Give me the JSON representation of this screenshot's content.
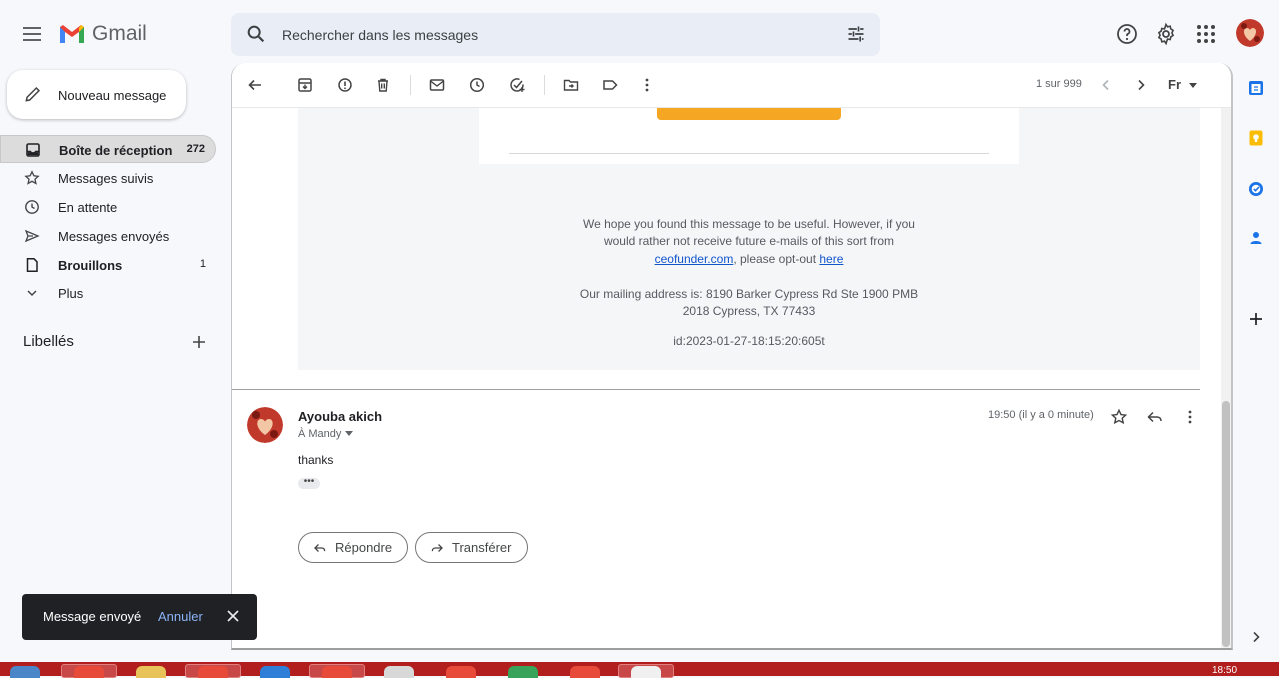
{
  "app": {
    "name": "Gmail"
  },
  "search": {
    "placeholder": "Rechercher dans les messages"
  },
  "compose": {
    "label": "Nouveau message"
  },
  "nav": [
    {
      "label": "Boîte de réception",
      "count": "272",
      "icon": "inbox-icon",
      "active": true
    },
    {
      "label": "Messages suivis",
      "count": "",
      "icon": "star-icon"
    },
    {
      "label": "En attente",
      "count": "",
      "icon": "clock-icon"
    },
    {
      "label": "Messages envoyés",
      "count": "",
      "icon": "send-icon"
    },
    {
      "label": "Brouillons",
      "count": "1",
      "icon": "draft-icon"
    },
    {
      "label": "Plus",
      "count": "",
      "icon": "chevron-down-icon"
    }
  ],
  "labels": {
    "title": "Libellés"
  },
  "toolbar": {
    "pager": "1 sur 999",
    "input_tools": "Fr"
  },
  "footer": {
    "line1": "We hope you found this message to be useful. However, if you",
    "line2": "would rather not receive future e-mails of this sort from",
    "link_site": "ceofunder.com",
    "optout_text": ", please opt-out ",
    "link_here": "here",
    "address1": "Our mailing address is: 8190 Barker Cypress Rd Ste 1900 PMB",
    "address2": "2018 Cypress, TX 77433",
    "id": "id:2023-01-27-18:15:20:605t"
  },
  "message": {
    "sender": "Ayouba akich",
    "recipient": "À Mandy",
    "time": "19:50 (il y a 0 minute)",
    "body": "thanks"
  },
  "actions": {
    "reply": "Répondre",
    "forward": "Transférer"
  },
  "snackbar": {
    "text": "Message envoyé",
    "undo": "Annuler"
  },
  "taskbar": {
    "clock": "18:50"
  },
  "colors": {
    "accent_blue": "#1a73e8",
    "gmail_red": "#ea4335",
    "orange_button": "#f5a623",
    "taskbar": "#b21d1d"
  }
}
